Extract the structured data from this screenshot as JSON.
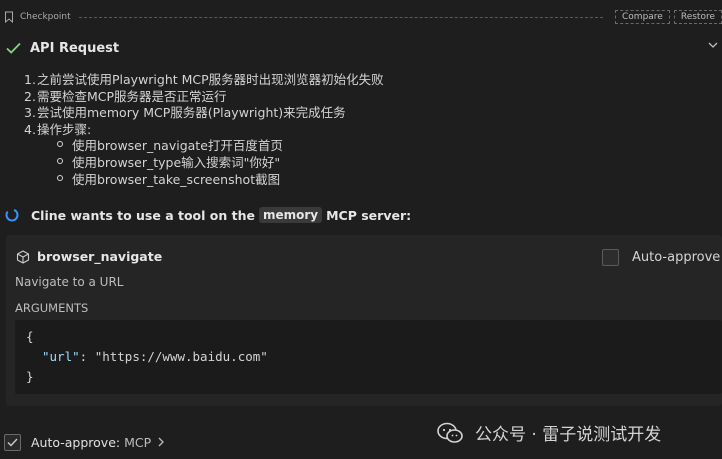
{
  "checkpoint": {
    "label": "Checkpoint",
    "compare_label": "Compare",
    "restore_label": "Restore"
  },
  "api_request": {
    "title": "API Request"
  },
  "plan": {
    "items": [
      {
        "num": "1.",
        "text": "之前尝试使用Playwright MCP服务器时出现浏览器初始化失败"
      },
      {
        "num": "2.",
        "text": "需要检查MCP服务器是否正常运行"
      },
      {
        "num": "3.",
        "text": "尝试使用memory MCP服务器(Playwright)来完成任务"
      },
      {
        "num": "4.",
        "text": "操作步骤:"
      }
    ],
    "subitems": [
      "使用browser_navigate打开百度首页",
      "使用browser_type输入搜索词\"你好\"",
      "使用browser_take_screenshot截图"
    ]
  },
  "tool_request": {
    "prefix": "Cline wants to use a tool on the",
    "server": "memory",
    "suffix": "MCP server:"
  },
  "tool": {
    "name": "browser_navigate",
    "auto_approve_label": "Auto-approve",
    "description": "Navigate to a URL",
    "arguments_label": "ARGUMENTS",
    "code": {
      "open": "{",
      "key": "\"url\"",
      "sep": ": ",
      "value": "\"https://www.baidu.com\"",
      "close": "}"
    }
  },
  "footer": {
    "auto_approve_label": "Auto-approve:",
    "auto_approve_value": "MCP"
  },
  "watermark": {
    "text": "公众号 · 雷子说测试开发"
  },
  "colors": {
    "background": "#1e1e1e",
    "panel": "#252526",
    "success_green": "#89d185",
    "spinner_blue": "#3794ff",
    "json_key": "#9cdcfe"
  }
}
